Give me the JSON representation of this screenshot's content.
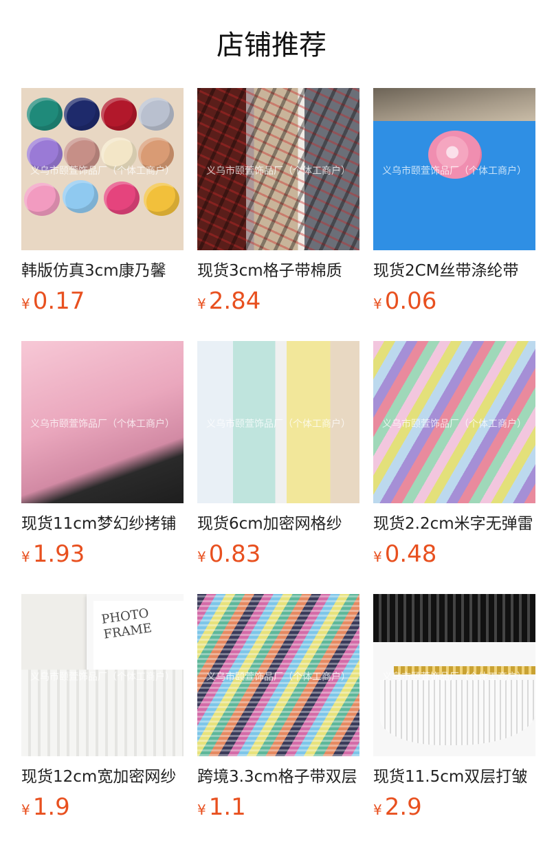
{
  "page": {
    "title": "店铺推荐"
  },
  "watermark": "义乌市颐萱饰品厂（个体工商户）",
  "currency": "¥",
  "products": [
    {
      "name": "韩版仿真3cm康乃馨",
      "price": "0.17",
      "image_icon": "ribbon-roses-image"
    },
    {
      "name": "现货3cm格子带棉质",
      "price": "2.84",
      "image_icon": "plaid-lace-trim-image"
    },
    {
      "name": "现货2CM丝带涤纶带",
      "price": "0.06",
      "image_icon": "pink-ribbon-rose-image"
    },
    {
      "name": "现货11cm梦幻纱拷铺",
      "price": "1.93",
      "image_icon": "pink-tulle-ruffle-image"
    },
    {
      "name": "现货6cm加密网格纱",
      "price": "0.83",
      "image_icon": "mesh-tulle-trim-image"
    },
    {
      "name": "现货2.2cm米字无弹雷",
      "price": "0.48",
      "image_icon": "rainbow-pleated-trim-image"
    },
    {
      "name": "现货12cm宽加密网纱",
      "price": "1.9",
      "image_icon": "white-mesh-ruffle-image"
    },
    {
      "name": "跨境3.3cm格子带双层",
      "price": "1.1",
      "image_icon": "gingham-pleated-trim-image"
    },
    {
      "name": "现货11.5cm双层打皱",
      "price": "2.9",
      "image_icon": "gold-edge-lace-image"
    }
  ]
}
